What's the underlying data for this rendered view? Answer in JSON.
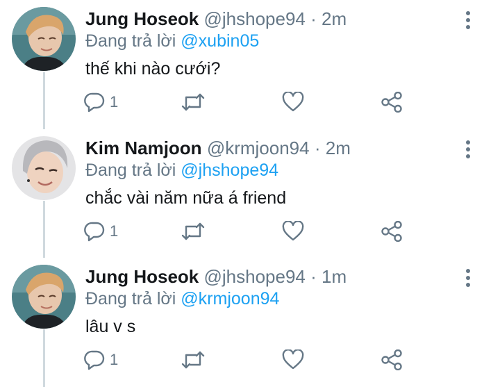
{
  "tweets": [
    {
      "name": "Jung Hoseok",
      "handle": "@jhshope94",
      "separator": "·",
      "time": "2m",
      "reply_prefix": "Đang trả lời",
      "reply_to": "@xubin05",
      "text": "thế khi nào cưới?",
      "reply_count": "1",
      "avatar_icon": "avatar-photo"
    },
    {
      "name": "Kim Namjoon",
      "handle": "@krmjoon94",
      "separator": "·",
      "time": "2m",
      "reply_prefix": "Đang trả lời",
      "reply_to": "@jhshope94",
      "text": "chắc vài năm nữa á friend",
      "reply_count": "1",
      "avatar_icon": "avatar-photo"
    },
    {
      "name": "Jung Hoseok",
      "handle": "@jhshope94",
      "separator": "·",
      "time": "1m",
      "reply_prefix": "Đang trả lời",
      "reply_to": "@krmjoon94",
      "text": "lâu v s",
      "reply_count": "1",
      "avatar_icon": "avatar-photo"
    }
  ],
  "icons": {
    "reply": "reply-icon",
    "retweet": "retweet-icon",
    "like": "heart-icon",
    "share": "share-icon",
    "more": "more-options-icon"
  },
  "colors": {
    "mention": "#1da1f2",
    "secondary_text": "#657786",
    "icon": "#657786",
    "thread_line": "#cfd9de"
  }
}
